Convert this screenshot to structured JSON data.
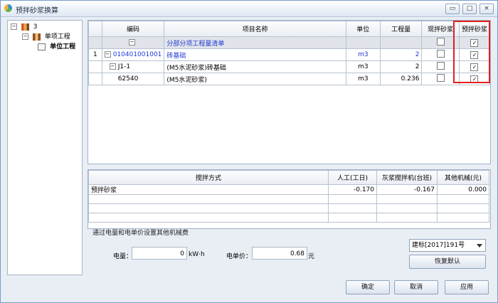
{
  "window": {
    "title": "预拌砂浆换算",
    "controls": [
      "▭",
      "□",
      "×"
    ]
  },
  "tree": {
    "root": "3",
    "child": "单项工程",
    "leaf": "单位工程"
  },
  "grid": {
    "headers": [
      "编码",
      "项目名称",
      "单位",
      "工程量",
      "现拌砂浆",
      "预拌砂浆"
    ],
    "rows": [
      {
        "no": "",
        "code": "",
        "name": "分部分项工程量清单",
        "unit": "",
        "qty": "",
        "mix": false,
        "ready": true
      },
      {
        "no": "1",
        "code": "010401001001",
        "name": "砖基础",
        "unit": "m3",
        "qty": "2",
        "mix": false,
        "ready": true
      },
      {
        "no": "",
        "code": "J1-1",
        "name": "(M5水泥砂浆)砖基础",
        "unit": "m3",
        "qty": "2",
        "mix": false,
        "ready": true
      },
      {
        "no": "",
        "code": "62540",
        "name": "(M5水泥砂浆)",
        "unit": "m3",
        "qty": "0.236",
        "mix": false,
        "ready": true
      }
    ]
  },
  "bottom_table": {
    "headers": [
      "搅拌方式",
      "人工(工日)",
      "灰浆搅拌机(台班)",
      "其他机械(元)"
    ],
    "rows": [
      [
        "预拌砂浆",
        "-0.170",
        "-0.167",
        "0.000"
      ]
    ]
  },
  "power": {
    "section": "通过电量和电单价设置其他机械费",
    "qty_label": "电量：",
    "qty_value": "0",
    "qty_unit": "kW·h",
    "price_label": "电单价：",
    "price_value": "0.68",
    "price_unit": "元"
  },
  "preset": {
    "selected": "建标[2017]191号",
    "reset": "恢复默认"
  },
  "buttons": {
    "ok": "确定",
    "cancel": "取消",
    "apply": "应用"
  },
  "accent": "#e02020"
}
